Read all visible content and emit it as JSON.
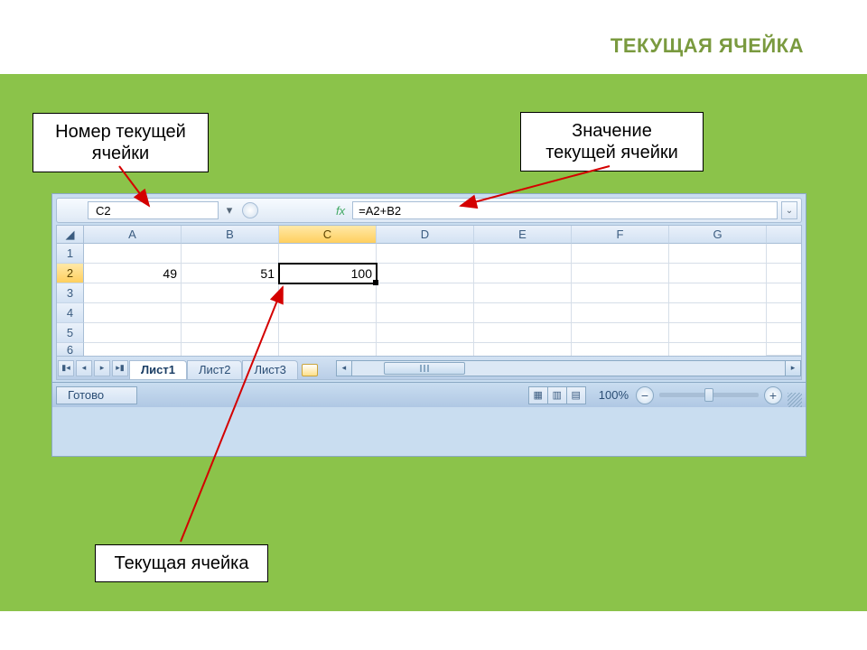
{
  "title": "ТЕКУЩАЯ ЯЧЕЙКА",
  "callouts": {
    "cell_ref": "Номер текущей\nячейки",
    "cell_value": "Значение\nтекущей ячейки",
    "current_cell": "Текущая ячейка"
  },
  "formula_bar": {
    "name_box": "C2",
    "fx_label": "fx",
    "formula": "=A2+B2"
  },
  "columns": [
    "A",
    "B",
    "C",
    "D",
    "E",
    "F",
    "G"
  ],
  "rows": [
    {
      "n": "1",
      "cells": [
        "",
        "",
        "",
        "",
        "",
        "",
        ""
      ]
    },
    {
      "n": "2",
      "cells": [
        "49",
        "51",
        "100",
        "",
        "",
        "",
        ""
      ]
    },
    {
      "n": "3",
      "cells": [
        "",
        "",
        "",
        "",
        "",
        "",
        ""
      ]
    },
    {
      "n": "4",
      "cells": [
        "",
        "",
        "",
        "",
        "",
        "",
        ""
      ]
    },
    {
      "n": "5",
      "cells": [
        "",
        "",
        "",
        "",
        "",
        "",
        ""
      ]
    },
    {
      "n": "6",
      "cells": [
        "",
        "",
        "",
        "",
        "",
        "",
        ""
      ]
    }
  ],
  "active_col": "C",
  "active_row": "2",
  "selected": {
    "row": 1,
    "col": 2
  },
  "sheets": {
    "tabs": [
      "Лист1",
      "Лист2",
      "Лист3"
    ],
    "active": 0
  },
  "status": {
    "ready": "Готово",
    "zoom": "100%"
  },
  "icons": {
    "minus": "−",
    "plus": "+"
  }
}
